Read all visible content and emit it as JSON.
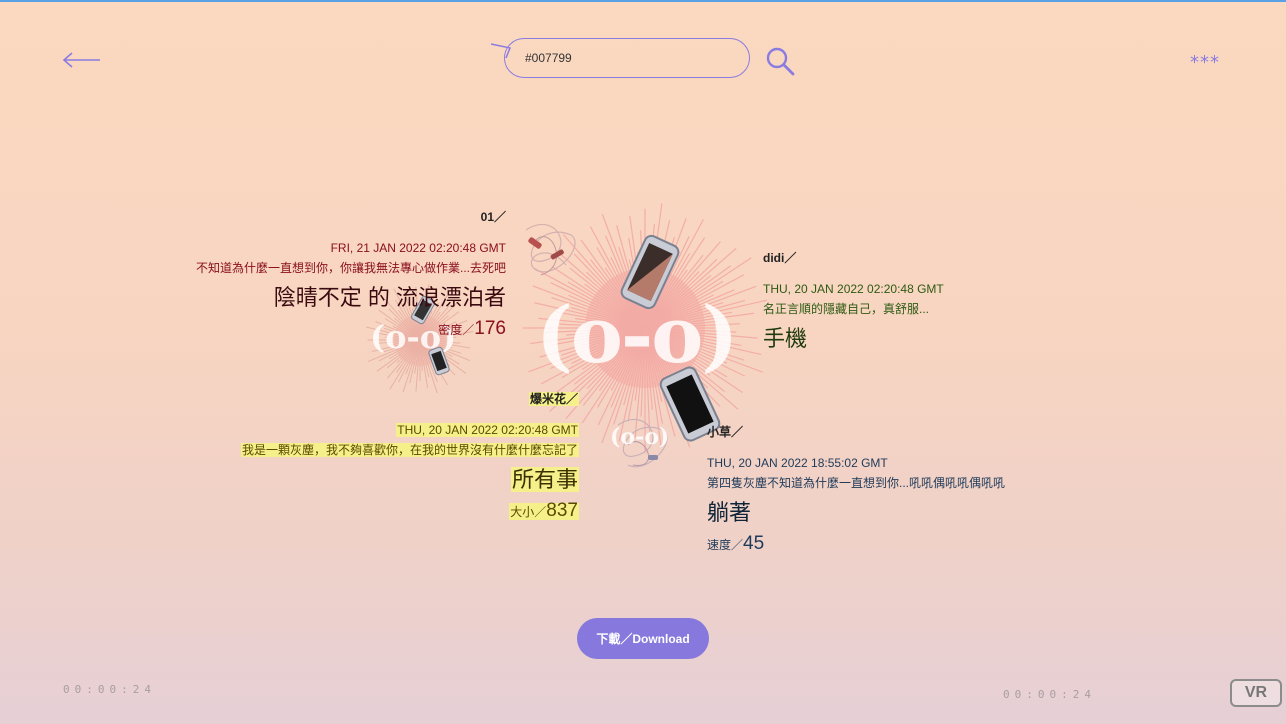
{
  "search": {
    "value": "#007799"
  },
  "menu_label": "***",
  "faces": {
    "large": "(o-o)",
    "left": "(o-o)",
    "bottom": "(o-o)"
  },
  "entries": [
    {
      "name": "01／",
      "date": "FRI, 21 JAN 2022 02:20:48 GMT",
      "message": "不知道為什麼一直想到你，你讓我無法專心做作業...去死吧",
      "title": "陰晴不定 的 流浪漂泊者",
      "metric_label": "密度／",
      "metric_value": "176",
      "color": "#8a1020"
    },
    {
      "name": "didi／",
      "date": "THU, 20 JAN 2022 02:20:48 GMT",
      "message": "名正言順的隱藏自己，真舒服...",
      "title": "手機",
      "color": "#2d5a12"
    },
    {
      "name": "爆米花／",
      "date": "THU, 20 JAN 2022 02:20:48 GMT",
      "message": "我是一顆灰塵，我不夠喜歡你，在我的世界沒有什麼什麼忘記了",
      "title": "所有事",
      "metric_label": "大小／",
      "metric_value": "837",
      "color": "#5a4a00",
      "highlight": "#f6f08a"
    },
    {
      "name": "小草／",
      "date": "THU, 20 JAN 2022 18:55:02 GMT",
      "message": "第四隻灰塵不知道為什麼一直想到你...吼吼偶吼吼偶吼吼",
      "title": "躺著",
      "metric_label": "速度／",
      "metric_value": "45",
      "color": "#1e3a5a"
    }
  ],
  "download_label": "下載／Download",
  "timers": {
    "left": "00:00:24",
    "right": "00:00:24"
  },
  "vr_label": "VR",
  "colors": {
    "accent": "#8678dc",
    "background_top": "#fbd9c0",
    "background_bottom": "#e6d0d6"
  }
}
